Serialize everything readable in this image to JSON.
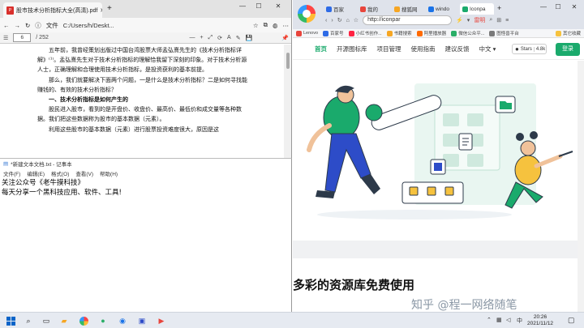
{
  "pdf": {
    "tab_title": "股市技术分析指标大全(高清).pdf",
    "file_label": "文件",
    "url": "C:/Users/h/Deskt...",
    "page_current": "6",
    "page_total": "/ 252",
    "lines": [
      {
        "text": "五年前，我曾经策划出版过中国台湾股票大师孟弘熹先生的《技术分析指标详解》⁽¹⁾。孟弘熹先生对于技术分析指标的理解恰我留下深刻的印象。对于技术分析源人士，正确理解和合理使用技术分析指标，是投资获利的基本前提。",
        "type": "p"
      },
      {
        "text": "那么，我们就要解决下面两个问题，一是什么是技术分析指标？二是如何寻找能赚钱的、有效的技术分析指标？",
        "type": "p"
      },
      {
        "text": "一、技术分析指标是如何产生的",
        "type": "h"
      },
      {
        "text": "股民进入股市，看到的是开盘价、收盘价、最高价、最低价和成交量等各种数据。我们把这些数据称为股市的基本数据（元素）。",
        "type": "p"
      },
      {
        "text": "利用这些股市的基本数据（元素）进行股票投资难度很大，原因是这",
        "type": "p"
      }
    ]
  },
  "notepad": {
    "title": "*新建文本文档.txt - 记事本",
    "menu": [
      "文件(F)",
      "编辑(E)",
      "格式(O)",
      "查看(V)",
      "帮助(H)"
    ],
    "lines": [
      "关注公众号《老牛摸科技》",
      "每天分享一个黑科技应用、软件、工具!"
    ]
  },
  "browser": {
    "tabs": [
      {
        "label": "百家",
        "color": "#2e6be6"
      },
      {
        "label": "我的",
        "color": "#e8453c"
      },
      {
        "label": "搜狐网",
        "color": "#f6a623"
      },
      {
        "label": "windo",
        "color": "#1a73e8"
      },
      {
        "label": "Iconpa",
        "color": "#1aaa6c"
      }
    ],
    "url": "http://iconpar",
    "search_hint": "雷明",
    "bookmarks": [
      "Lenovo",
      "百家号",
      "小红书创作...",
      "书籍搜索",
      "阿里播放器",
      "微信公众平...",
      "图怪兽平台",
      "其它收藏"
    ]
  },
  "site": {
    "nav": [
      "首页",
      "开源图标库",
      "项目管理",
      "使用指南",
      "建议反馈",
      "中文"
    ],
    "stars_label": "Stars",
    "stars_count": "4.8k",
    "login": "登录",
    "headline": "多彩的资源库免费使用",
    "watermark": "知乎 @程一网络随笔"
  },
  "taskbar": {
    "time": "20:26",
    "date": "2021/11/12",
    "ime": "中"
  }
}
